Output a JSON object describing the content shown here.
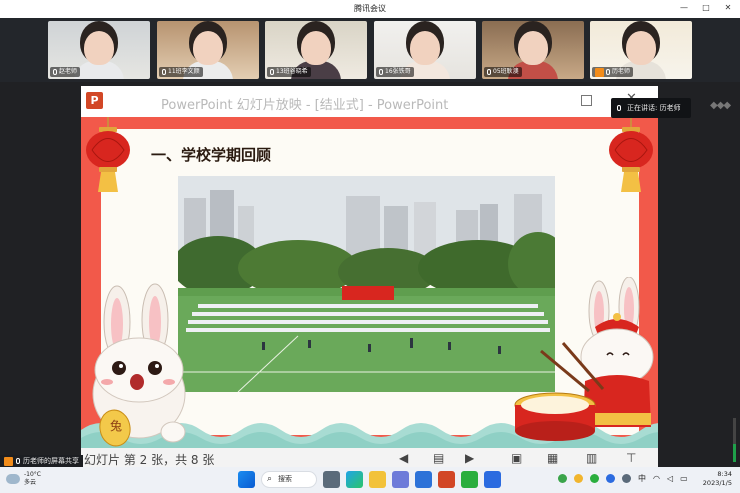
{
  "window": {
    "title": "腾讯会议"
  },
  "participants": [
    {
      "name": "赵老师"
    },
    {
      "name": "11班李文颜"
    },
    {
      "name": "13班谷晓希"
    },
    {
      "name": "16张铁哥"
    },
    {
      "name": "05班耿澳"
    },
    {
      "name": "历老师"
    }
  ],
  "speaking": {
    "label": "正在讲话: 历老师"
  },
  "ppt": {
    "title": "PowerPoint 幻灯片放映 - [结业式] - PowerPoint",
    "logo": "P",
    "slide_heading": "一、学校学期回顾",
    "slide_counter": "幻灯片 第 2 张，共 8 张",
    "rabbit_coin": "兔"
  },
  "sharing": {
    "label": "历老师的屏幕共享"
  },
  "taskbar": {
    "weather_temp": "-10°C",
    "weather_desc": "多云",
    "search_label": "搜索",
    "ime": "中",
    "time": "8:34",
    "date": "2023/1/5"
  }
}
